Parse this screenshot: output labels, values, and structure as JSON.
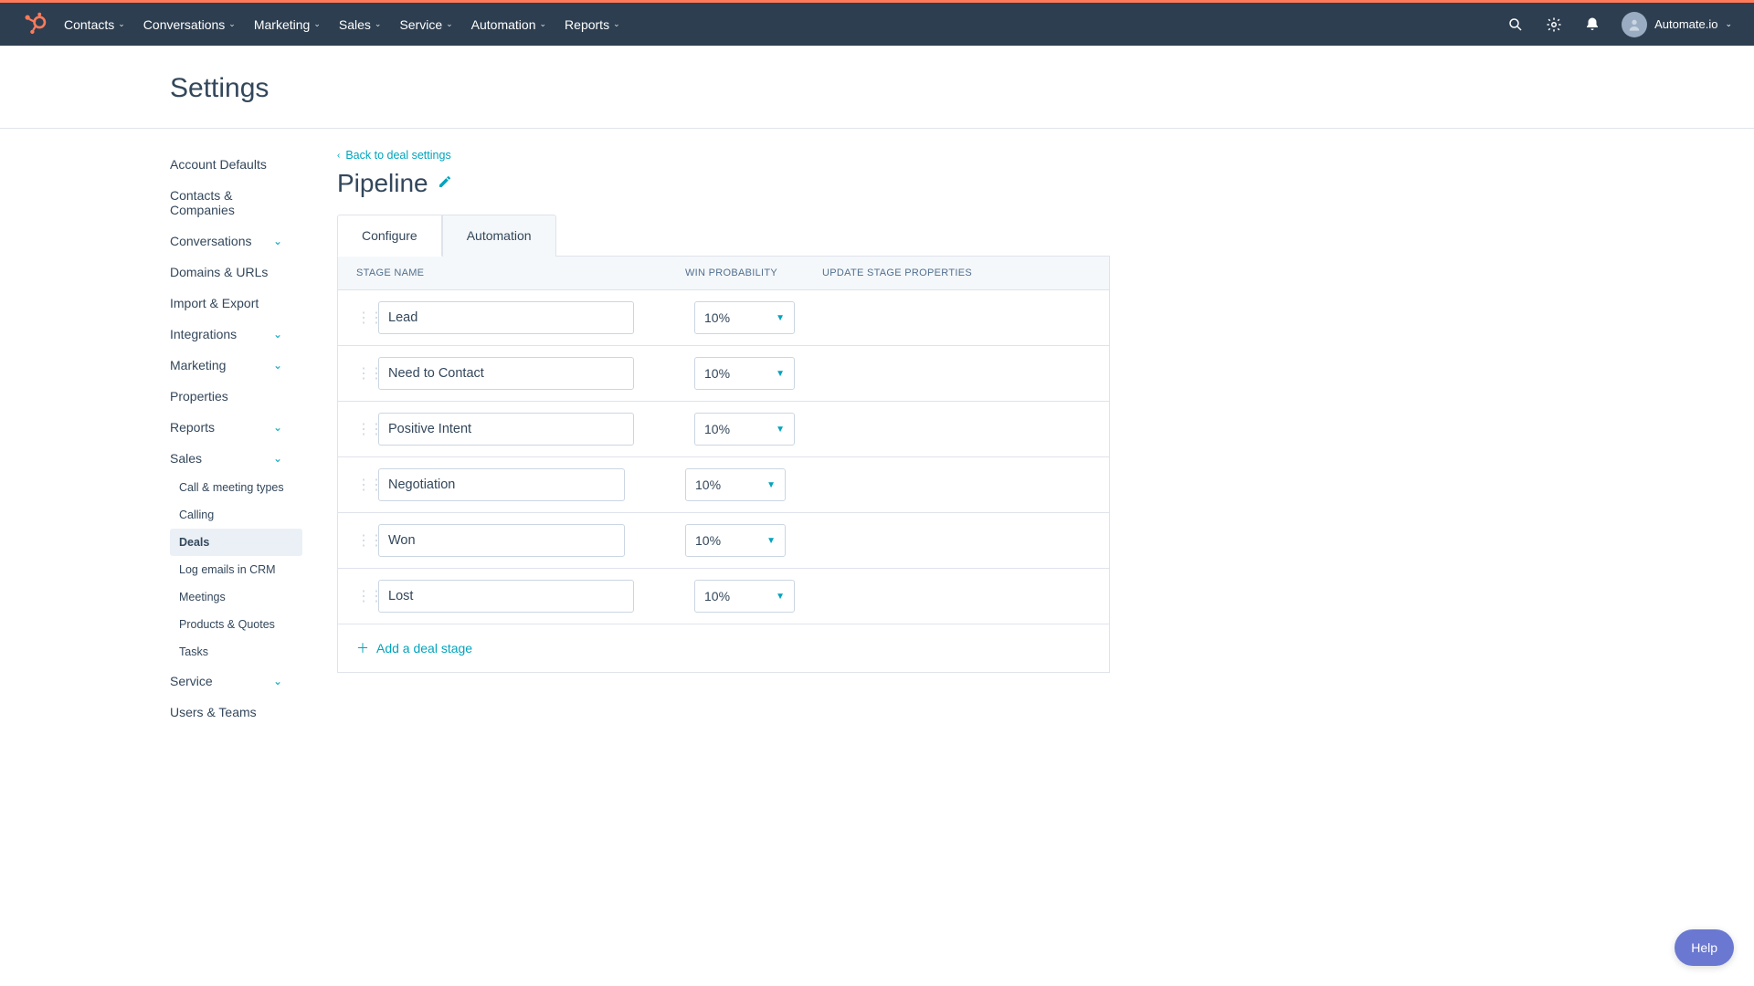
{
  "nav": {
    "items": [
      "Contacts",
      "Conversations",
      "Marketing",
      "Sales",
      "Service",
      "Automation",
      "Reports"
    ],
    "account": "Automate.io"
  },
  "page_title": "Settings",
  "sidebar": {
    "items": [
      {
        "label": "Account Defaults",
        "expand": false
      },
      {
        "label": "Contacts & Companies",
        "expand": false
      },
      {
        "label": "Conversations",
        "expand": true
      },
      {
        "label": "Domains & URLs",
        "expand": false
      },
      {
        "label": "Import & Export",
        "expand": false
      },
      {
        "label": "Integrations",
        "expand": true
      },
      {
        "label": "Marketing",
        "expand": true
      },
      {
        "label": "Properties",
        "expand": false
      },
      {
        "label": "Reports",
        "expand": true
      },
      {
        "label": "Sales",
        "expand": true,
        "open": true,
        "children": [
          {
            "label": "Call & meeting types"
          },
          {
            "label": "Calling"
          },
          {
            "label": "Deals",
            "active": true
          },
          {
            "label": "Log emails in CRM"
          },
          {
            "label": "Meetings"
          },
          {
            "label": "Products & Quotes"
          },
          {
            "label": "Tasks"
          }
        ]
      },
      {
        "label": "Service",
        "expand": true
      },
      {
        "label": "Users & Teams",
        "expand": false
      }
    ]
  },
  "back_link": "Back to deal settings",
  "pipeline_title": "Pipeline",
  "tabs": [
    "Configure",
    "Automation"
  ],
  "active_tab": 0,
  "columns": {
    "name": "STAGE NAME",
    "prob": "WIN PROBABILITY",
    "update": "UPDATE STAGE PROPERTIES"
  },
  "stages": [
    {
      "name": "Lead",
      "prob": "10%"
    },
    {
      "name": "Need to Contact",
      "prob": "10%"
    },
    {
      "name": "Positive Intent",
      "prob": "10%"
    },
    {
      "name": "Negotiation",
      "prob": "10%"
    },
    {
      "name": "Won",
      "prob": "10%"
    },
    {
      "name": "Lost",
      "prob": "10%"
    }
  ],
  "add_stage": "Add a deal stage",
  "help": "Help"
}
